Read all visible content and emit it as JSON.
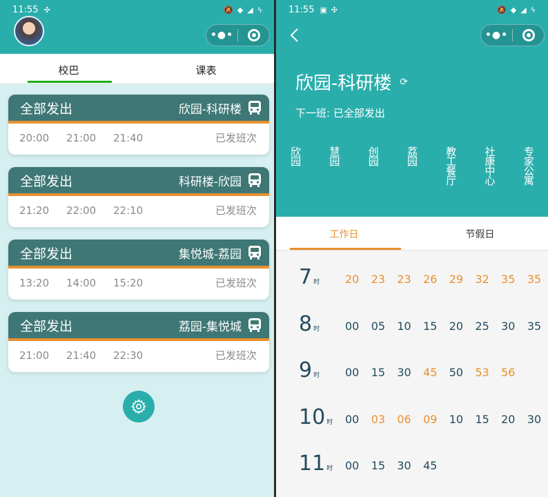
{
  "left": {
    "status": {
      "time": "11:55"
    },
    "tabs": [
      "校巴",
      "课表"
    ],
    "cards": [
      {
        "status": "全部发出",
        "route": "欣园-科研楼",
        "times": [
          "20:00",
          "21:00",
          "21:40"
        ],
        "done": "已发班次"
      },
      {
        "status": "全部发出",
        "route": "科研楼-欣园",
        "times": [
          "21:20",
          "22:00",
          "22:10"
        ],
        "done": "已发班次"
      },
      {
        "status": "全部发出",
        "route": "集悦城-荔园",
        "times": [
          "13:20",
          "14:00",
          "15:20"
        ],
        "done": "已发班次"
      },
      {
        "status": "全部发出",
        "route": "荔园-集悦城",
        "times": [
          "21:00",
          "21:40",
          "22:30"
        ],
        "done": "已发班次"
      }
    ]
  },
  "right": {
    "status": {
      "time": "11:55"
    },
    "title": "欣园-科研楼",
    "next_bus": "下一班: 已全部发出",
    "stops": [
      "欣园",
      "慧园",
      "创园",
      "荔园",
      "教工餐厅",
      "社康中心",
      "专家公寓"
    ],
    "tabs": [
      "工作日",
      "节假日"
    ],
    "hour_suffix": "时",
    "schedule": [
      {
        "hour": "7",
        "mins": [
          {
            "v": "20",
            "hl": true
          },
          {
            "v": "23",
            "hl": true
          },
          {
            "v": "23",
            "hl": true
          },
          {
            "v": "26",
            "hl": true
          },
          {
            "v": "29",
            "hl": true
          },
          {
            "v": "32",
            "hl": true
          },
          {
            "v": "35",
            "hl": true
          },
          {
            "v": "35",
            "hl": true
          }
        ]
      },
      {
        "hour": "8",
        "mins": [
          {
            "v": "00",
            "hl": false
          },
          {
            "v": "05",
            "hl": false
          },
          {
            "v": "10",
            "hl": false
          },
          {
            "v": "15",
            "hl": false
          },
          {
            "v": "20",
            "hl": false
          },
          {
            "v": "25",
            "hl": false
          },
          {
            "v": "30",
            "hl": false
          },
          {
            "v": "35",
            "hl": false
          }
        ]
      },
      {
        "hour": "9",
        "mins": [
          {
            "v": "00",
            "hl": false
          },
          {
            "v": "15",
            "hl": false
          },
          {
            "v": "30",
            "hl": false
          },
          {
            "v": "45",
            "hl": true
          },
          {
            "v": "50",
            "hl": false
          },
          {
            "v": "53",
            "hl": true
          },
          {
            "v": "56",
            "hl": true
          }
        ]
      },
      {
        "hour": "10",
        "mins": [
          {
            "v": "00",
            "hl": false
          },
          {
            "v": "03",
            "hl": true
          },
          {
            "v": "06",
            "hl": true
          },
          {
            "v": "09",
            "hl": true
          },
          {
            "v": "10",
            "hl": false
          },
          {
            "v": "15",
            "hl": false
          },
          {
            "v": "20",
            "hl": false
          },
          {
            "v": "30",
            "hl": false
          }
        ]
      },
      {
        "hour": "11",
        "mins": [
          {
            "v": "00",
            "hl": false
          },
          {
            "v": "15",
            "hl": false
          },
          {
            "v": "30",
            "hl": false
          },
          {
            "v": "45",
            "hl": false
          }
        ]
      }
    ]
  },
  "colors": {
    "teal": "#2aaeac",
    "card_header": "#3e7775",
    "accent_orange": "#e8902f",
    "tab_green": "#1aad19",
    "text_dark": "#234b5e"
  },
  "icons": {
    "bus": "bus-icon",
    "settings": "gear-icon",
    "back": "chevron-left-icon",
    "refresh": "refresh-icon",
    "menu": "more-dots-icon",
    "close": "target-circle-icon"
  }
}
